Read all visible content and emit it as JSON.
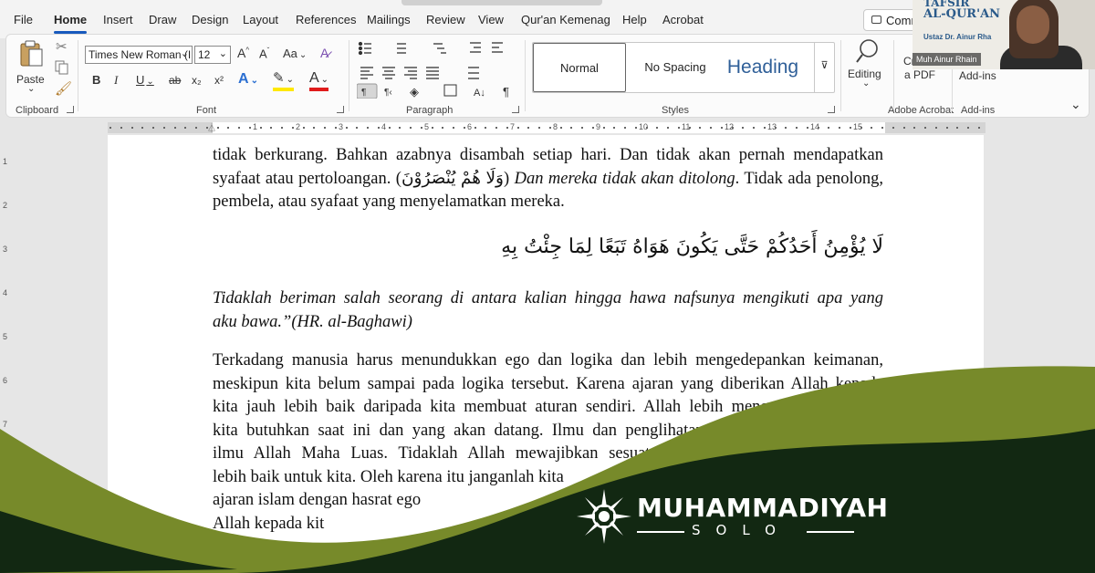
{
  "menu": {
    "tabs": [
      "File",
      "Home",
      "Insert",
      "Draw",
      "Design",
      "Layout",
      "References",
      "Mailings",
      "Review",
      "View",
      "Qur'an Kemenag",
      "Help",
      "Acrobat"
    ],
    "active": "Home",
    "comments_label": "Comme"
  },
  "ribbon": {
    "clipboard": {
      "paste": "Paste",
      "label": "Clipboard"
    },
    "font": {
      "family": "Times New Roman (I",
      "size": "12",
      "grow": "A^",
      "shrink": "A˅",
      "case": "Aa",
      "bold": "B",
      "italic": "I",
      "underline": "U",
      "strike": "ab",
      "subscript": "x₂",
      "superscript": "x²",
      "effects": "A",
      "highlight": "✎",
      "color": "A",
      "label": "Font"
    },
    "paragraph": {
      "label": "Paragraph"
    },
    "styles": {
      "items": [
        "Normal",
        "No Spacing",
        "Heading"
      ],
      "label": "Styles"
    },
    "editing": {
      "label": "Editing"
    },
    "acrobat": {
      "btn": "Create a PDF",
      "btn_line1": "Create",
      "btn_line2": "a PDF",
      "label": "Adobe Acrobat"
    },
    "addins": {
      "btn": "Add-ins",
      "label": "Add-ins"
    }
  },
  "ruler": {
    "h": [
      "1",
      "2",
      "3",
      "4",
      "5",
      "6",
      "7",
      "8",
      "9",
      "10",
      "11",
      "12",
      "13",
      "14",
      "15"
    ],
    "v": [
      "1",
      "2",
      "3",
      "4",
      "5",
      "6",
      "7"
    ]
  },
  "document": {
    "p1_a": "tidak berkurang. Bahkan azabnya disambah setiap hari. Dan tidak akan pernah mendapatkan",
    "p1_b": "syafaat atau pertoloangan. (وَلَا هُمْ يُنْصَرُوْنَ)",
    "p1_c": "Dan mereka tidak akan ditolong",
    "p1_d": ". Tidak ada penolong,",
    "p1_e": "pembela, atau syafaat yang menyelamatkan mereka.",
    "arabic": "لَا يُؤْمِنُ أَحَدُكُمْ حَتَّى يَكُونَ هَوَاهُ تَبَعًا لِمَا جِئْتُ بِهِ",
    "hadith_1": "Tidaklah beriman salah seorang di antara kalian hingga hawa nafsunya mengikuti apa yang",
    "hadith_2": "aku bawa.”(HR. al-Baghawi)",
    "p3": [
      "Terkadang manusia harus menundukkan ego dan logika dan lebih mengedepankan keimanan,",
      "meskipun kita belum sampai pada logika tersebut. Karena ajaran yang diberikan Allah kepada",
      "kita jauh lebih baik daripada kita membuat aturan sendiri. Allah lebih mengetahui apa yang",
      "kita butuhkan saat ini dan yang akan datang. Ilmu dan penglihatan kita terbatas, sedangkan",
      "ilmu Allah Maha Luas. Tidaklah Allah mewajibkan sesuatu kepada kita melainkan untuk",
      "lebih baik untuk kita. Oleh karena itu janganlah kita",
      "ajaran islam dengan hasrat ego",
      "Allah kepada kit"
    ]
  },
  "video": {
    "title_1": "TAFSIR",
    "title_2": "AL-QUR'AN",
    "speaker": "Ustaz Dr. Ainur Rha",
    "name_tag": "Muh Ainur Rhain"
  },
  "brand": {
    "word": "MUHAMMADIYAH",
    "city": "SOLO",
    "colors": {
      "olive": "#778a2a",
      "dark": "#122812"
    }
  }
}
